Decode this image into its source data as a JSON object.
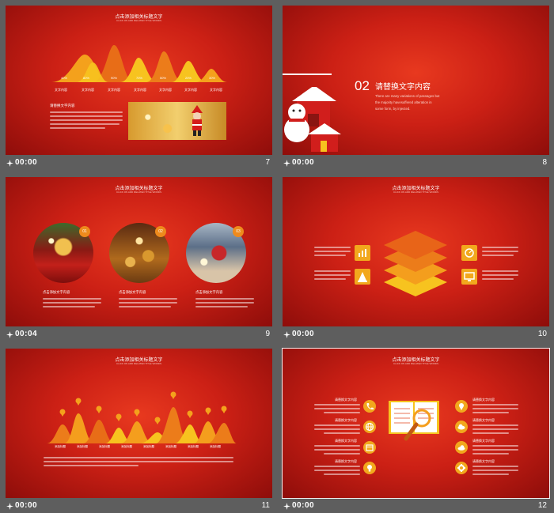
{
  "thumbnails": [
    {
      "number": "7",
      "timing": "00:00",
      "title": "点击添加相关标题文字",
      "subtitle": "CLICK ON ADD RELATED TITLE WORDS",
      "percents": [
        "40%",
        "80%",
        "90%",
        "70%",
        "50%",
        "20%",
        "30%"
      ],
      "labels": [
        "文字内容",
        "文字内容",
        "文字内容",
        "文字内容",
        "文字内容",
        "文字内容",
        "文字内容"
      ],
      "heading": "请替换文字内容"
    },
    {
      "number": "8",
      "timing": "00:00",
      "section_number": "02",
      "section_title": "请替换文字内容",
      "body": [
        "There are many variations of passages but",
        "the majority havesuffered alteration in",
        "some form, by injected."
      ]
    },
    {
      "number": "9",
      "timing": "00:04",
      "title": "点击添加相关标题文字",
      "subtitle": "CLICK ON ADD RELATED TITLE WORDS",
      "badges": [
        "01",
        "02",
        "03"
      ],
      "headings": [
        "点击添加文字内容",
        "点击添加文字内容",
        "点击添加文字内容"
      ]
    },
    {
      "number": "10",
      "timing": "00:00",
      "title": "点击添加相关标题文字",
      "subtitle": "CLICK ON ADD RELATED TITLE WORDS"
    },
    {
      "number": "11",
      "timing": "00:00",
      "title": "点击添加相关标题文字",
      "subtitle": "CLICK ON ADD RELATED TITLE WORDS",
      "labels": [
        "添加标题",
        "添加标题",
        "添加标题",
        "添加标题",
        "添加标题",
        "添加标题",
        "添加标题",
        "添加标题"
      ]
    },
    {
      "number": "12",
      "timing": "00:00",
      "title": "点击添加相关标题文字",
      "subtitle": "CLICK ON ADD RELATED TITLE WORDS",
      "headings": [
        "请替换文字内容",
        "请替换文字内容",
        "请替换文字内容",
        "请替换文字内容",
        "请替换文字内容",
        "请替换文字内容",
        "请替换文字内容",
        "请替换文字内容"
      ]
    }
  ],
  "colors": {
    "background": "#5e5e5e",
    "slide_red": "#cc2015",
    "accent_orange": "#ee8a1c",
    "accent_yellow": "#f7c31f"
  },
  "icons": {
    "animation": "star-sparkle-icon",
    "slide4": [
      "bar-chart-icon",
      "cone-icon",
      "compass-icon",
      "monitor-icon"
    ],
    "slide6": [
      "phone-icon",
      "globe-icon",
      "calendar-icon",
      "lightbulb-icon",
      "location-pin-icon",
      "cloud-upload-icon",
      "cloud-icon",
      "gear-icon"
    ]
  }
}
